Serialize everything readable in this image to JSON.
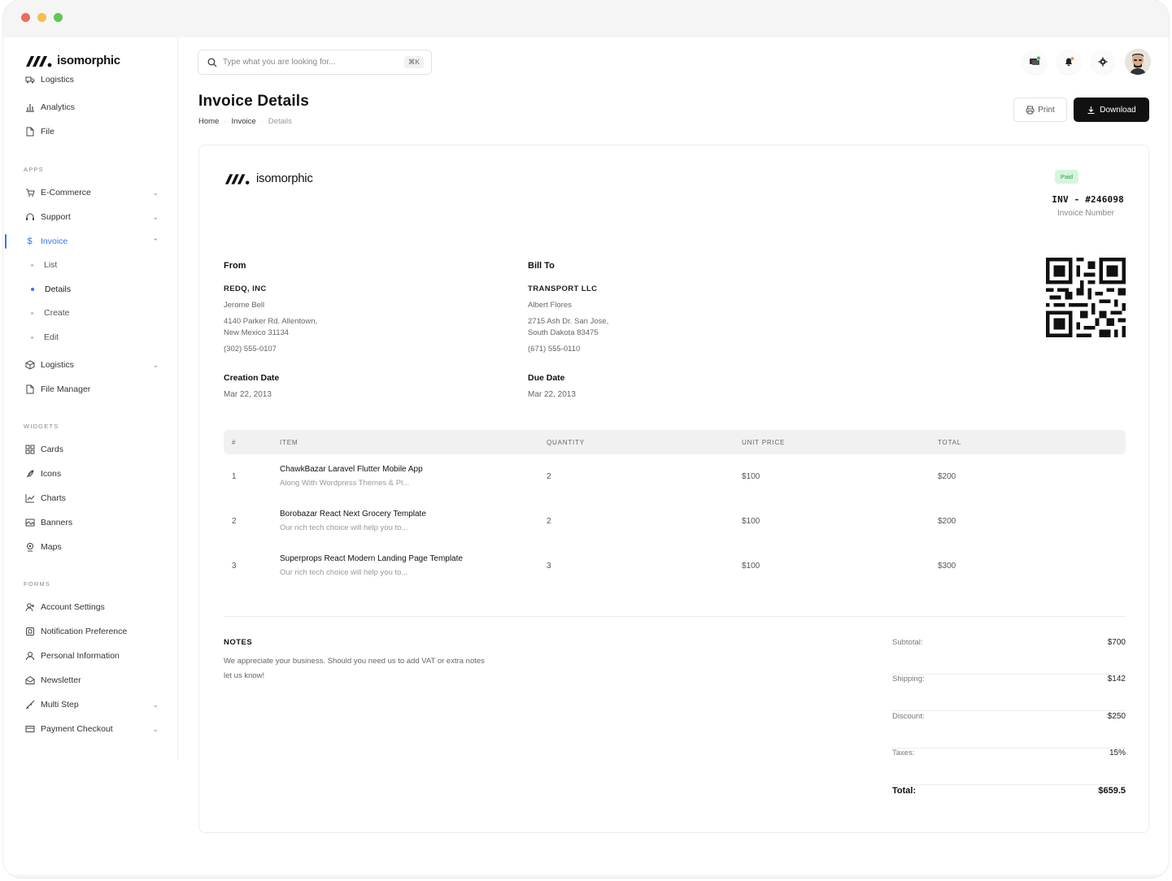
{
  "brand": {
    "name": "isomorphic"
  },
  "sidebar": {
    "top_items": [
      {
        "label": "Logistics",
        "icon": "truck-icon"
      },
      {
        "label": "Analytics",
        "icon": "bar-chart-icon"
      },
      {
        "label": "File",
        "icon": "file-icon"
      }
    ],
    "sections": {
      "apps": "APPS",
      "widgets": "WIDGETS",
      "forms": "FORMS"
    },
    "apps": [
      {
        "label": "E-Commerce",
        "icon": "cart-icon",
        "chevron": "down"
      },
      {
        "label": "Support",
        "icon": "headset-icon",
        "chevron": "down"
      },
      {
        "label": "Invoice",
        "icon": "dollar-icon",
        "chevron": "up",
        "active": true
      },
      {
        "label": "Logistics",
        "icon": "box-icon",
        "chevron": "down"
      },
      {
        "label": "File Manager",
        "icon": "file-icon"
      }
    ],
    "invoice_sub": [
      {
        "label": "List"
      },
      {
        "label": "Details",
        "active": true
      },
      {
        "label": "Create"
      },
      {
        "label": "Edit"
      }
    ],
    "widgets": [
      {
        "label": "Cards",
        "icon": "grid-icon"
      },
      {
        "label": "Icons",
        "icon": "feather-icon"
      },
      {
        "label": "Charts",
        "icon": "line-chart-icon"
      },
      {
        "label": "Banners",
        "icon": "image-icon"
      },
      {
        "label": "Maps",
        "icon": "map-pin-icon"
      }
    ],
    "forms": [
      {
        "label": "Account Settings",
        "icon": "user-plus-icon"
      },
      {
        "label": "Notification Preference",
        "icon": "bell-square-icon"
      },
      {
        "label": "Personal Information",
        "icon": "user-icon"
      },
      {
        "label": "Newsletter",
        "icon": "mail-icon"
      },
      {
        "label": "Multi Step",
        "icon": "steps-icon",
        "chevron": "down"
      },
      {
        "label": "Payment Checkout",
        "icon": "card-icon",
        "chevron": "down"
      }
    ]
  },
  "header": {
    "search_placeholder": "Type what you are looking for...",
    "search_shortcut": "⌘K",
    "icons": [
      "messages-icon",
      "bell-icon",
      "settings-icon",
      "avatar"
    ],
    "colors": {
      "message_dot": "#2fbf4b",
      "bell_dot": "#f2994a"
    }
  },
  "page": {
    "title": "Invoice Details",
    "breadcrumbs": [
      "Home",
      "Invoice",
      "Details"
    ],
    "print_label": "Print",
    "download_label": "Download"
  },
  "invoice": {
    "status": "Paid",
    "number": "INV - #246098",
    "number_label": "Invoice Number",
    "from": {
      "heading": "From",
      "company": "REDQ, INC",
      "name": "Jerome Bell",
      "address1": "4140 Parker Rd. Allentown,",
      "address2": "New Mexico 31134",
      "phone": "(302) 555-0107"
    },
    "bill_to": {
      "heading": "Bill To",
      "company": "TRANSPORT LLC",
      "name": "Albert Flores",
      "address1": "2715 Ash Dr. San Jose,",
      "address2": "South Dakota 83475",
      "phone": "(671) 555-0110"
    },
    "creation_date": {
      "label": "Creation Date",
      "value": "Mar 22, 2013"
    },
    "due_date": {
      "label": "Due Date",
      "value": "Mar 22, 2013"
    },
    "columns": [
      "#",
      "ITEM",
      "QUANTITY",
      "UNIT PRICE",
      "TOTAL"
    ],
    "items": [
      {
        "no": "1",
        "title": "ChawkBazar Laravel Flutter Mobile App",
        "desc": "Along With Wordpress Themes & Pl...",
        "qty": "2",
        "price": "$100",
        "total": "$200"
      },
      {
        "no": "2",
        "title": "Borobazar React Next Grocery Template",
        "desc": "Our rich tech choice will help you to...",
        "qty": "2",
        "price": "$100",
        "total": "$200"
      },
      {
        "no": "3",
        "title": "Superprops React Modern Landing Page Template",
        "desc": "Our rich tech choice will help you to...",
        "qty": "3",
        "price": "$100",
        "total": "$300"
      }
    ],
    "notes": {
      "heading": "NOTES",
      "text": "We appreciate your business. Should you need us to add VAT or extra notes let us know!"
    },
    "summary": [
      {
        "label": "Subtotal:",
        "value": "$700"
      },
      {
        "label": "Shipping:",
        "value": "$142"
      },
      {
        "label": "Discount:",
        "value": "$250"
      },
      {
        "label": "Taxes:",
        "value": "15%"
      }
    ],
    "total": {
      "label": "Total:",
      "value": "$659.5"
    }
  },
  "colors": {
    "accent": "#3872fa",
    "paid_bg": "#d6f5dd",
    "paid_text": "#2b9a48",
    "dark": "#111111"
  }
}
